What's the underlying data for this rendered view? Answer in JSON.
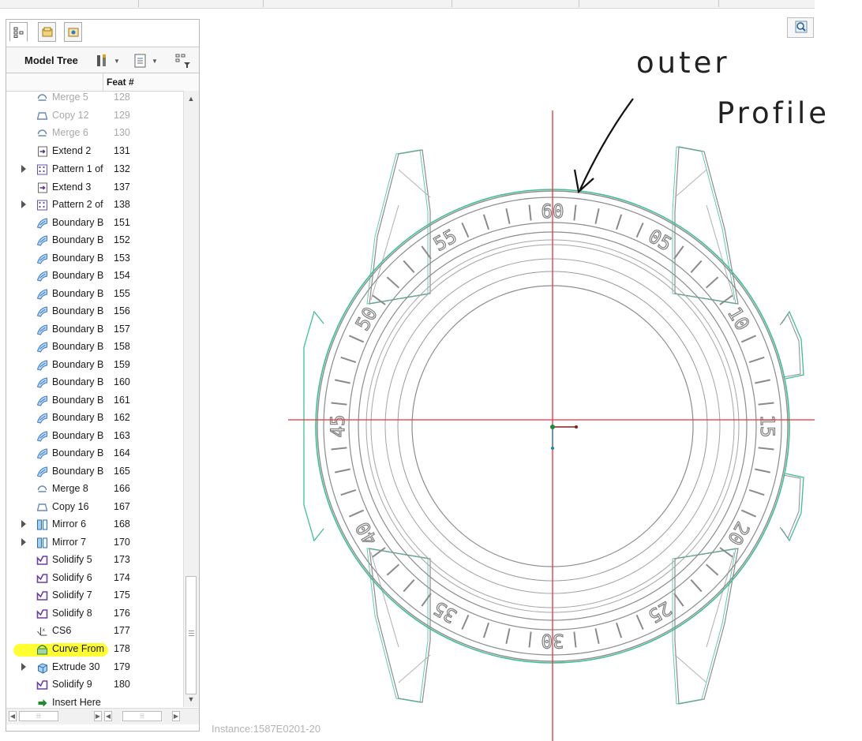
{
  "panel": {
    "toolbar_title": "Model Tree",
    "column_header": "Feat #",
    "tabs": [
      {
        "icon": "model-tree-tab-icon",
        "active": true
      },
      {
        "icon": "folder-browser-tab-icon",
        "active": false
      },
      {
        "icon": "favorites-tab-icon",
        "active": false
      }
    ],
    "rows": [
      {
        "name": "Merge 5",
        "num": "128",
        "icon": "merge-icon",
        "dim": true,
        "expand": false
      },
      {
        "name": "Copy 12",
        "num": "129",
        "icon": "copy-icon",
        "dim": true,
        "expand": false
      },
      {
        "name": "Merge 6",
        "num": "130",
        "icon": "merge-icon",
        "dim": true,
        "expand": false
      },
      {
        "name": "Extend 2",
        "num": "131",
        "icon": "extend-icon",
        "expand": false
      },
      {
        "name": "Pattern 1 of",
        "num": "132",
        "icon": "pattern-icon",
        "expand": true
      },
      {
        "name": "Extend 3",
        "num": "137",
        "icon": "extend-icon",
        "expand": false
      },
      {
        "name": "Pattern 2 of",
        "num": "138",
        "icon": "pattern-icon",
        "expand": true
      },
      {
        "name": "Boundary B",
        "num": "151",
        "icon": "boundary-blend-icon"
      },
      {
        "name": "Boundary B",
        "num": "152",
        "icon": "boundary-blend-icon"
      },
      {
        "name": "Boundary B",
        "num": "153",
        "icon": "boundary-blend-icon"
      },
      {
        "name": "Boundary B",
        "num": "154",
        "icon": "boundary-blend-icon"
      },
      {
        "name": "Boundary B",
        "num": "155",
        "icon": "boundary-blend-icon"
      },
      {
        "name": "Boundary B",
        "num": "156",
        "icon": "boundary-blend-icon"
      },
      {
        "name": "Boundary B",
        "num": "157",
        "icon": "boundary-blend-icon"
      },
      {
        "name": "Boundary B",
        "num": "158",
        "icon": "boundary-blend-icon"
      },
      {
        "name": "Boundary B",
        "num": "159",
        "icon": "boundary-blend-icon"
      },
      {
        "name": "Boundary B",
        "num": "160",
        "icon": "boundary-blend-icon"
      },
      {
        "name": "Boundary B",
        "num": "161",
        "icon": "boundary-blend-icon"
      },
      {
        "name": "Boundary B",
        "num": "162",
        "icon": "boundary-blend-icon"
      },
      {
        "name": "Boundary B",
        "num": "163",
        "icon": "boundary-blend-icon"
      },
      {
        "name": "Boundary B",
        "num": "164",
        "icon": "boundary-blend-icon"
      },
      {
        "name": "Boundary B",
        "num": "165",
        "icon": "boundary-blend-icon"
      },
      {
        "name": "Merge 8",
        "num": "166",
        "icon": "merge-icon"
      },
      {
        "name": "Copy 16",
        "num": "167",
        "icon": "copy-icon"
      },
      {
        "name": "Mirror 6",
        "num": "168",
        "icon": "mirror-icon",
        "expand": true
      },
      {
        "name": "Mirror 7",
        "num": "170",
        "icon": "mirror-icon",
        "expand": true
      },
      {
        "name": "Solidify 5",
        "num": "173",
        "icon": "solidify-icon"
      },
      {
        "name": "Solidify 6",
        "num": "174",
        "icon": "solidify-icon"
      },
      {
        "name": "Solidify 7",
        "num": "175",
        "icon": "solidify-icon"
      },
      {
        "name": "Solidify 8",
        "num": "176",
        "icon": "solidify-icon"
      },
      {
        "name": "CS6",
        "num": "177",
        "icon": "coordinate-system-icon"
      },
      {
        "name": "Curve From",
        "num": "178",
        "icon": "curve-from-icon",
        "highlight": true
      },
      {
        "name": "Extrude 30",
        "num": "179",
        "icon": "extrude-icon",
        "expand": true
      },
      {
        "name": "Solidify 9",
        "num": "180",
        "icon": "solidify-icon"
      },
      {
        "name": "Insert Here",
        "num": "",
        "icon": "insert-arrow-icon"
      }
    ]
  },
  "canvas": {
    "instance_label": "Instance:1587E0201-20",
    "annotation_line1": "outer",
    "annotation_line2": "Profile",
    "bezel_numbers": [
      "60",
      "05",
      "10",
      "15",
      "20",
      "25",
      "30",
      "35",
      "40",
      "45",
      "50",
      "55"
    ],
    "colors": {
      "axis": "#e8313b",
      "outline": "#3fbf8f",
      "geometry": "#8c8c8c"
    }
  }
}
